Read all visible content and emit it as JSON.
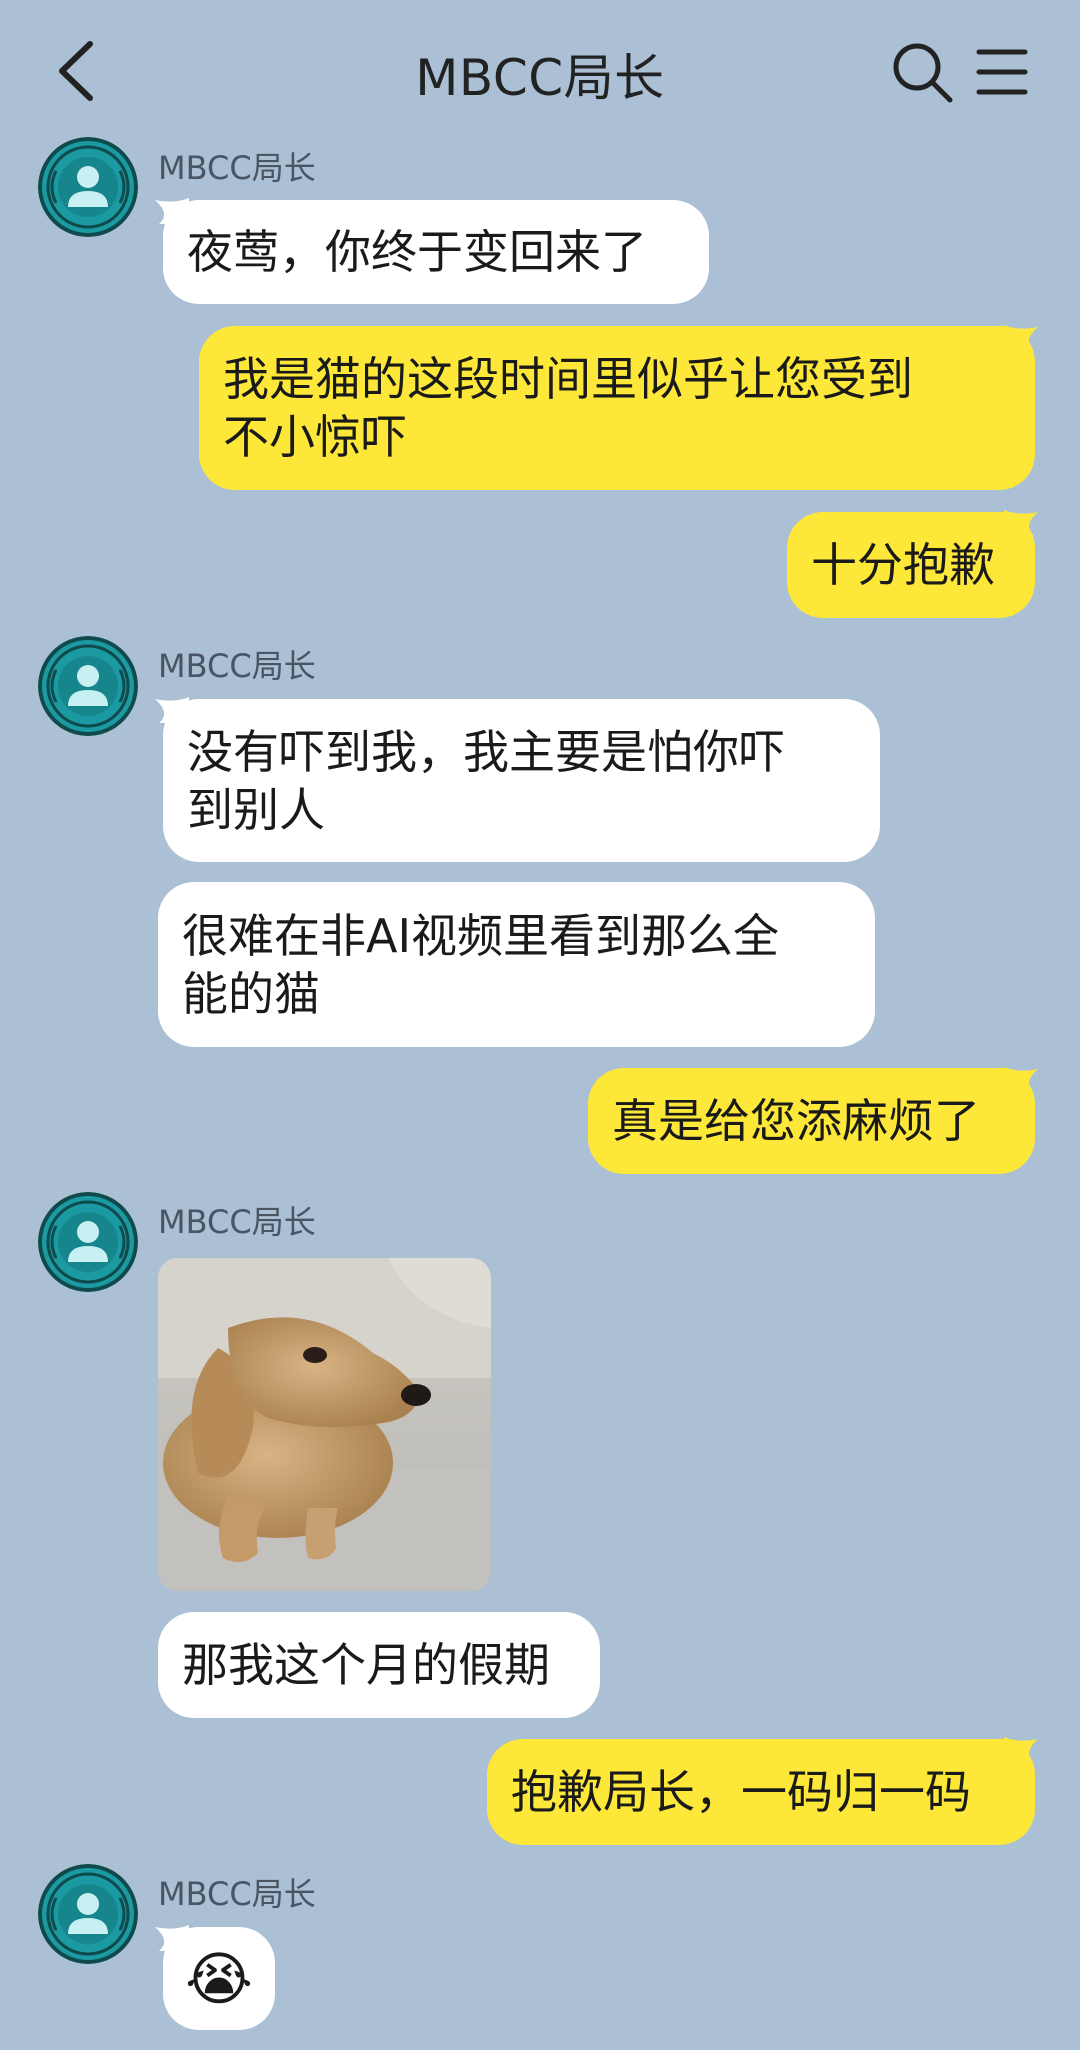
{
  "header": {
    "title": "MBCC局长"
  },
  "messages": {
    "m1": {
      "sender": "MBCC局长",
      "line1": "夜莺，你终于变回来了"
    },
    "m2": {
      "line1": "我是猫的这段时间里似乎让您受到",
      "line2": "不小惊吓"
    },
    "m3": {
      "line1": "十分抱歉"
    },
    "m4": {
      "sender": "MBCC局长",
      "line1": "没有吓到我，我主要是怕你吓",
      "line2": "到别人"
    },
    "m5": {
      "line1": "很难在非AI视频里看到那么全",
      "line2": "能的猫"
    },
    "m6": {
      "line1": "真是给您添麻烦了"
    },
    "m7": {
      "sender": "MBCC局长"
    },
    "m8": {
      "line1": "那我这个月的假期"
    },
    "m9": {
      "line1": "抱歉局长，一码归一码"
    },
    "m10": {
      "sender": "MBCC局长",
      "emoji": "😭"
    }
  },
  "colors": {
    "background": "#abc0d5",
    "incoming_bubble": "#ffffff",
    "outgoing_bubble": "#fde83a",
    "avatar_teal": "#1b9aa2"
  },
  "icons": {
    "back": "chevron-left-icon",
    "search": "search-icon",
    "menu": "hamburger-menu-icon",
    "avatar": "user-avatar-icon"
  }
}
